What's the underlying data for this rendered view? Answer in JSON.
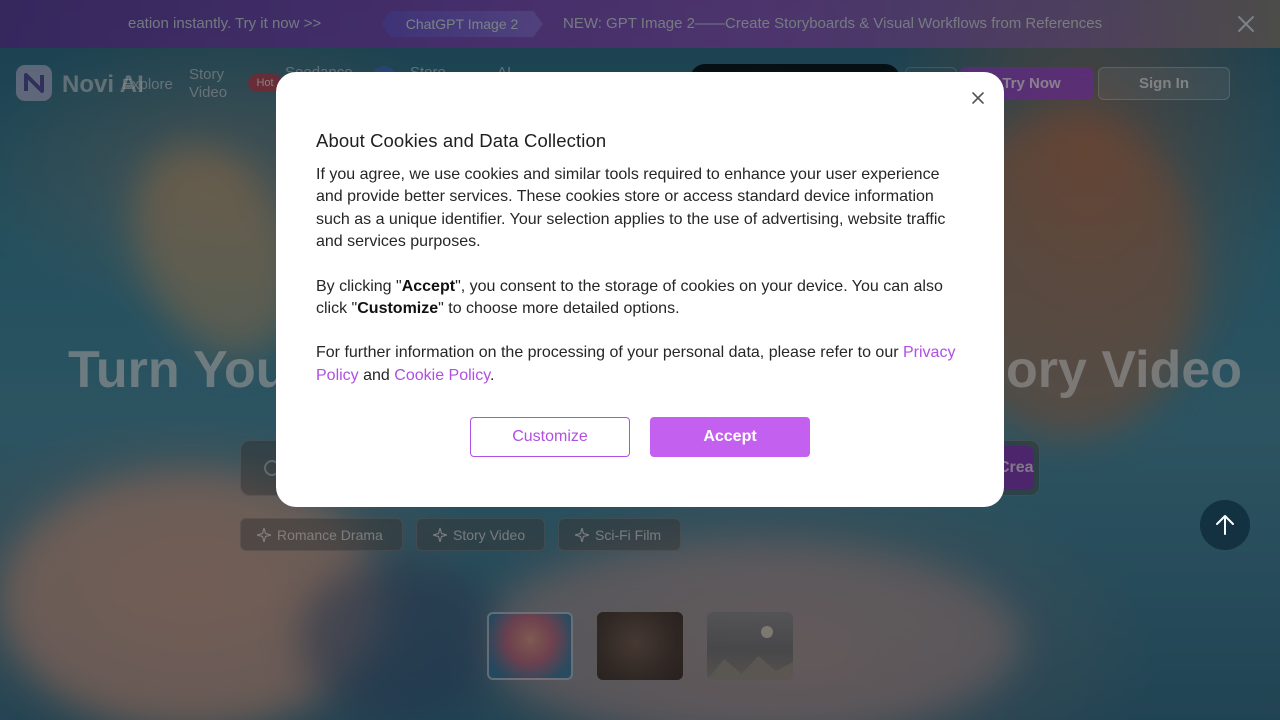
{
  "announcement": {
    "left_text": "eation instantly. Try it now >>",
    "chip_label": "ChatGPT Image 2",
    "right_text": "NEW: GPT Image 2——Create Storyboards & Visual Workflows from References",
    "close_icon": "close-icon"
  },
  "header": {
    "logo_text": "Novi AI",
    "nav": {
      "explore": "Explore",
      "story_video": "Story Video",
      "hot_badge": "Hot",
      "seedance": "Seedance",
      "store": "Store",
      "ai": "AI"
    },
    "try_now": "Try Now",
    "sign_in": "Sign In"
  },
  "hero": {
    "title_left": "Turn Your",
    "title_right": "ory Video",
    "create_button": "Create"
  },
  "tags": [
    "Romance Drama",
    "Story Video",
    "Sci-Fi Film"
  ],
  "cookie_modal": {
    "title": "About Cookies and Data Collection",
    "paragraph1": "If you agree, we use cookies and similar tools required to enhance your user experience and provide better services. These cookies store or access standard device information such as a unique identifier. Your selection applies to the use of advertising, website traffic and services purposes.",
    "p2_prefix": "By clicking \"",
    "p2_accept": "Accept",
    "p2_middle": "\", you consent to the storage of cookies on your device. You can also click \"",
    "p2_customize": "Customize",
    "p2_suffix": "\" to choose more detailed options.",
    "p3_prefix": "For further information on the processing of your personal data, please refer to our ",
    "privacy_link": "Privacy Policy",
    "p3_and": " and ",
    "cookie_link": "Cookie Policy",
    "p3_suffix": ".",
    "customize_button": "Customize",
    "accept_button": "Accept"
  },
  "colors": {
    "accent": "#c460f0",
    "link": "#b04fe3"
  }
}
